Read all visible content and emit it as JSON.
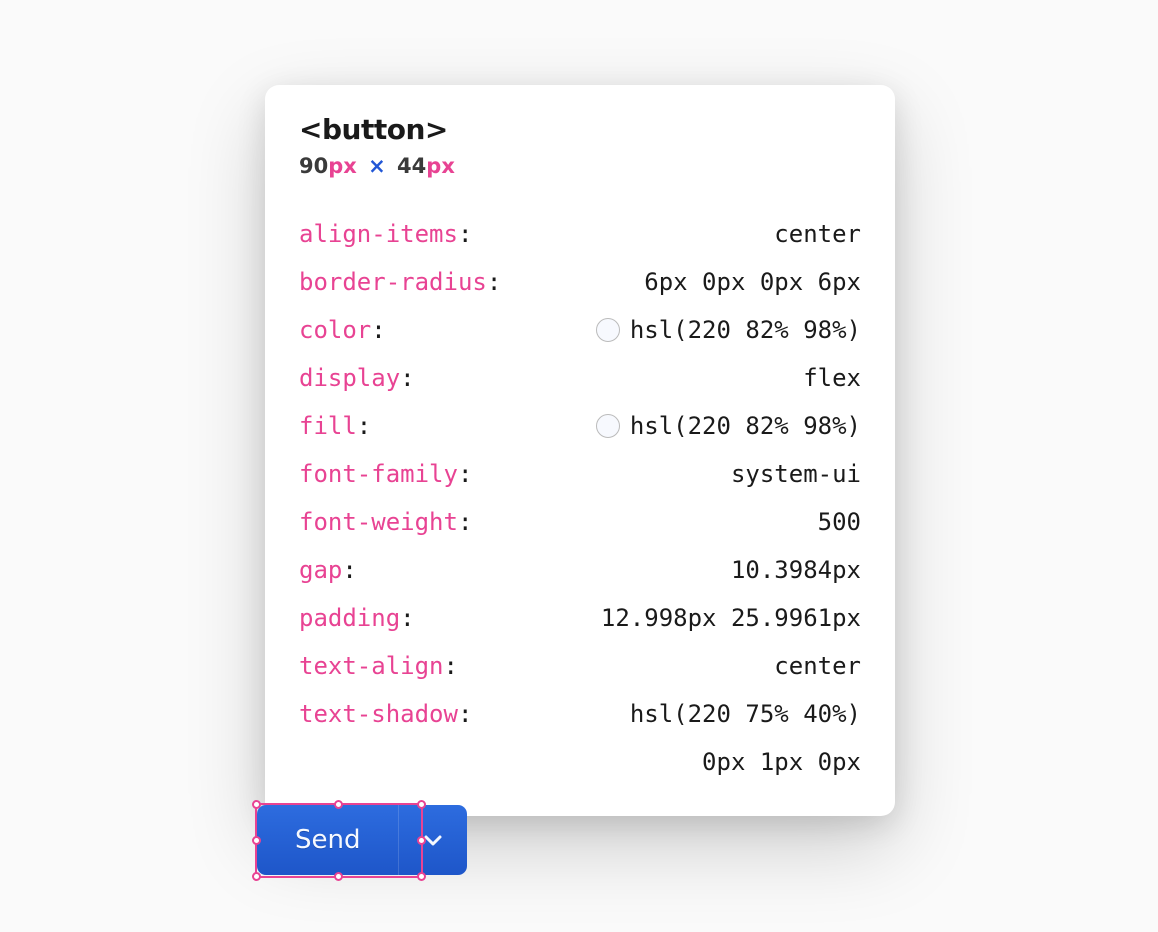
{
  "tooltip": {
    "element_tag": "<button>",
    "dimensions": {
      "width": "90",
      "width_unit": "px",
      "times": "×",
      "height": "44",
      "height_unit": "px"
    },
    "properties": [
      {
        "name": "align-items",
        "value": "center",
        "swatch": false
      },
      {
        "name": "border-radius",
        "value": "6px 0px 0px 6px",
        "swatch": false
      },
      {
        "name": "color",
        "value": "hsl(220 82% 98%)",
        "swatch": true
      },
      {
        "name": "display",
        "value": "flex",
        "swatch": false
      },
      {
        "name": "fill",
        "value": "hsl(220 82% 98%)",
        "swatch": true
      },
      {
        "name": "font-family",
        "value": "system-ui",
        "swatch": false
      },
      {
        "name": "font-weight",
        "value": "500",
        "swatch": false
      },
      {
        "name": "gap",
        "value": "10.3984px",
        "swatch": false
      },
      {
        "name": "padding",
        "value": "12.998px 25.9961px",
        "swatch": false
      },
      {
        "name": "text-align",
        "value": "center",
        "swatch": false
      },
      {
        "name": "text-shadow",
        "value": "hsl(220 75% 40%)",
        "value2": "0px 1px 0px",
        "swatch": false
      }
    ]
  },
  "button": {
    "send_label": "Send"
  }
}
